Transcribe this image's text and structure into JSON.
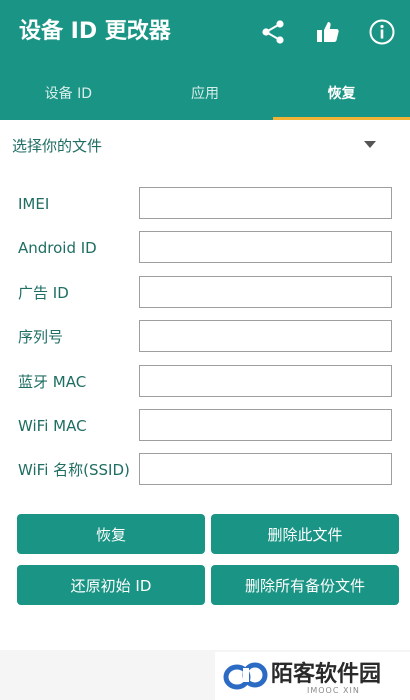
{
  "appbar": {
    "title": "设备 ID 更改器",
    "actions": [
      {
        "icon": "share-icon"
      },
      {
        "icon": "thumbs-up-icon"
      },
      {
        "icon": "info-icon"
      }
    ]
  },
  "tabs": [
    {
      "label": "设备 ID",
      "active": false
    },
    {
      "label": "应用",
      "active": false
    },
    {
      "label": "恢复",
      "active": true
    }
  ],
  "file_select": {
    "label": "选择你的文件"
  },
  "fields": [
    {
      "label": "IMEI",
      "value": ""
    },
    {
      "label": "Android ID",
      "value": ""
    },
    {
      "label": "广告 ID",
      "value": ""
    },
    {
      "label": "序列号",
      "value": ""
    },
    {
      "label": "蓝牙 MAC",
      "value": ""
    },
    {
      "label": "WiFi MAC",
      "value": ""
    },
    {
      "label": "WiFi 名称(SSID)",
      "value": ""
    }
  ],
  "buttons": {
    "restore": "恢复",
    "delete_file": "删除此文件",
    "reset_initial": "还原初始 ID",
    "delete_all": "删除所有备份文件"
  },
  "watermark": {
    "text": "陌客软件园",
    "subtext": "IMOOC XIN"
  },
  "colors": {
    "primary": "#1a9484",
    "tab_indicator": "#f2b233",
    "label_text": "#1f6e63"
  }
}
